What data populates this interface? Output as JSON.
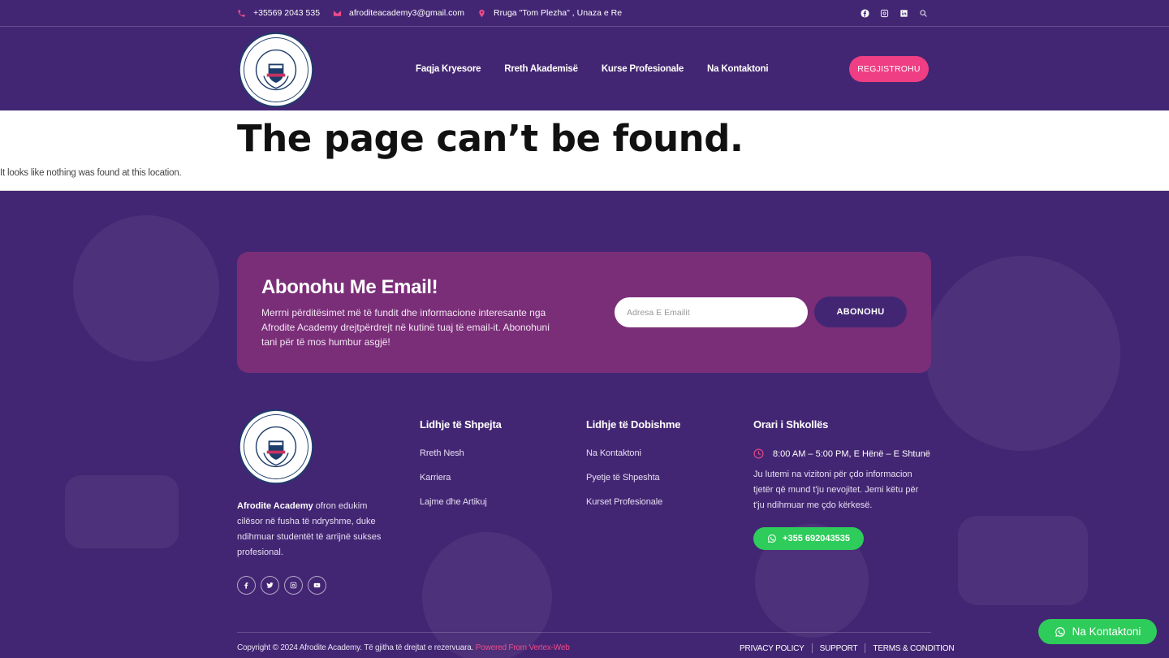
{
  "topbar": {
    "phone": "+35569 2043 535",
    "email": "afroditeacademy3@gmail.com",
    "address": "Rruga \"Tom Plezha\" , Unaza e Re",
    "social_icons": [
      "facebook-icon",
      "instagram-icon",
      "linkedin-icon",
      "search-icon"
    ]
  },
  "logo": {
    "ring_text": "AKADEMIA MULTIFUNKSIONALE",
    "name": "Afrodite",
    "emblem": "AMA"
  },
  "nav": {
    "items": [
      "Faqja Kryesore",
      "Rreth Akademisë",
      "Kurse Profesionale",
      "Na Kontaktoni"
    ],
    "register_label": "REGJISTROHU"
  },
  "notfound": {
    "title": "The page can’t be found.",
    "message": "It looks like nothing was found at this location."
  },
  "subscribe": {
    "title": "Abonohu Me Email!",
    "text": "Merrni përditësimet më të fundit dhe informacione interesante nga Afrodite Academy drejtpërdrejt në kutinë tuaj të email-it. Abonohuni tani për të mos humbur asgjë!",
    "email_placeholder": "Adresa E Emailit",
    "button_label": "ABONOHU"
  },
  "footer": {
    "about_name": "Afrodite Academy",
    "about_text": " ofron edukim cilësor në fusha të ndryshme, duke ndihmuar studentët të arrijnë sukses profesional.",
    "social_icons": [
      "facebook-icon",
      "twitter-icon",
      "instagram-icon",
      "youtube-icon"
    ],
    "quick_links": {
      "title": "Lidhje të Shpejta",
      "items": [
        "Rreth Nesh",
        "Karriera",
        "Lajme dhe Artikuj"
      ]
    },
    "useful_links": {
      "title": "Lidhje të Dobishme",
      "items": [
        "Na Kontaktoni",
        "Pyetje të Shpeshta",
        "Kurset Profesionale"
      ]
    },
    "schedule": {
      "title": "Orari i Shkollës",
      "hours": "8:00 AM – 5:00 PM, E Hënë – E Shtunë",
      "info": "Ju lutemi na vizitoni për çdo informacion tjetër që mund t'ju nevojitet. Jemi këtu për t'ju ndihmuar me çdo kërkesë.",
      "phone_button": "+355 692043535"
    },
    "copyright": "Copyright © 2024 Afrodite Academy. Të gjitha të drejtat e rezervuara. ",
    "powered": "Powered From Vertex-Web",
    "legal_links": [
      "PRIVACY POLICY",
      "SUPPORT",
      "TERMS & CONDITION"
    ]
  },
  "whatsapp_float": "Na Kontaktoni",
  "colors": {
    "primary": "#432673",
    "accent": "#ef3e83",
    "subscribe_bg": "#7a2e78",
    "whatsapp": "#2ecc5a"
  }
}
